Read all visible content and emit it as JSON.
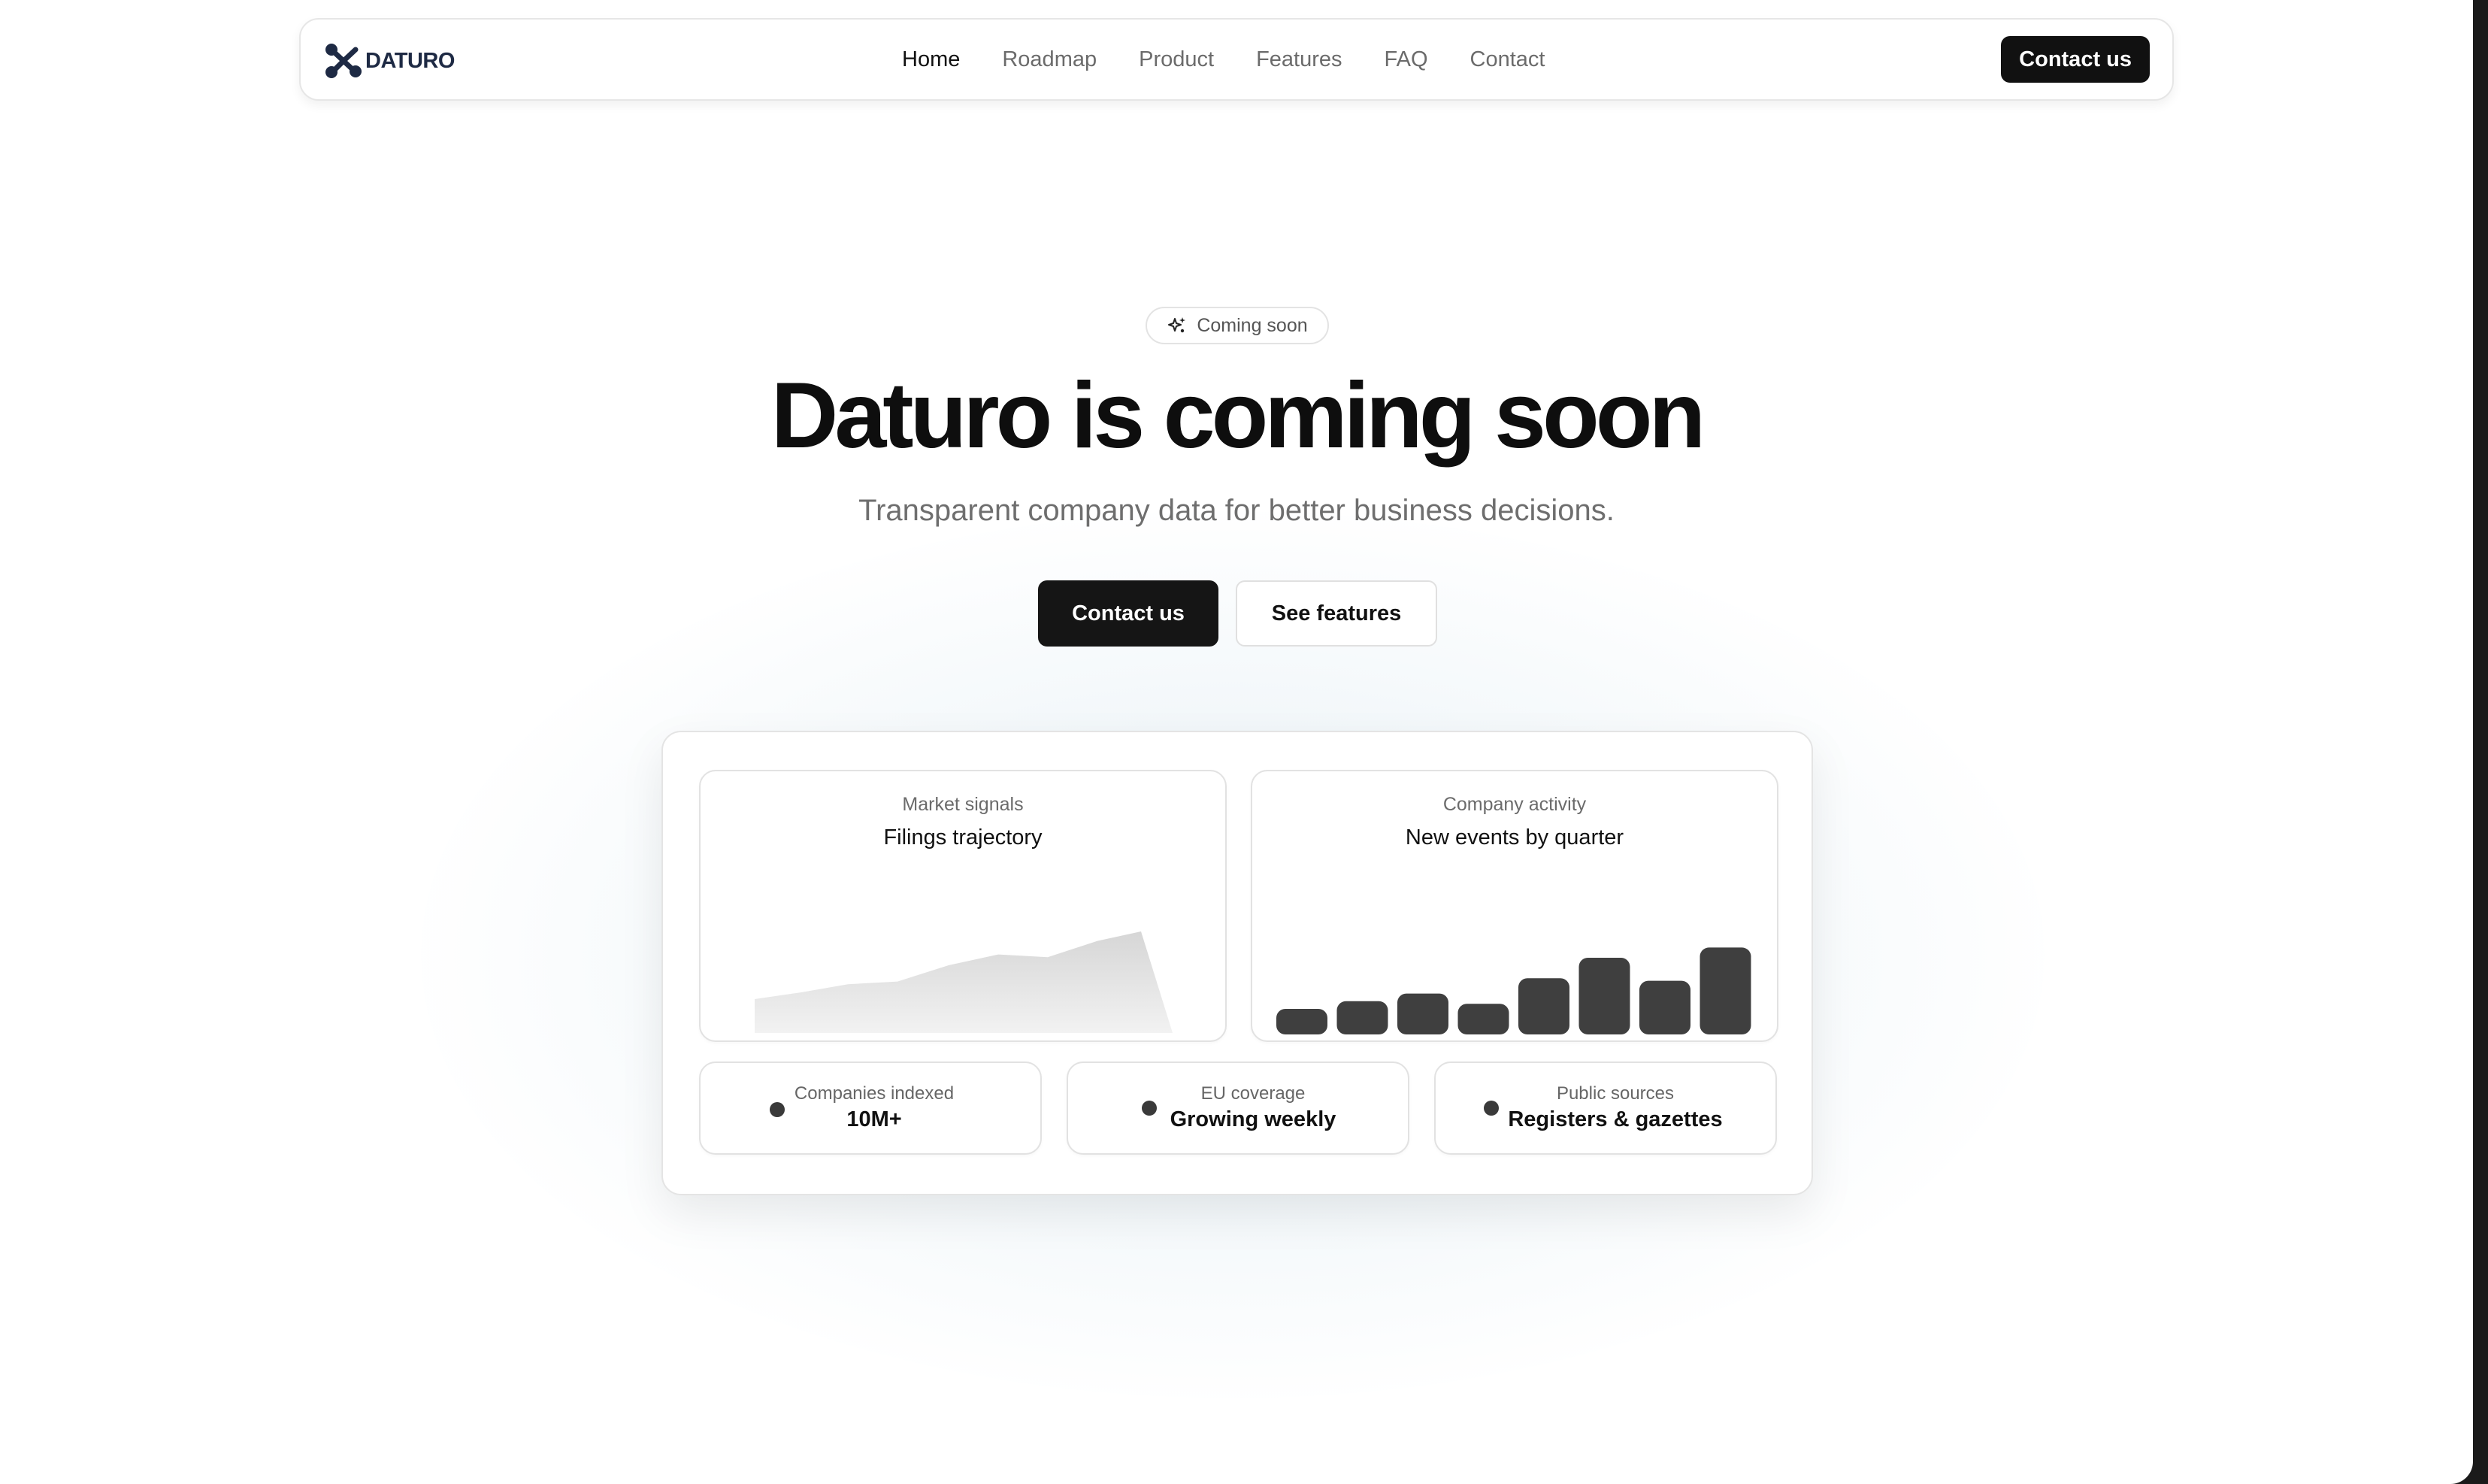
{
  "nav": {
    "brand": "DATURO",
    "links": [
      {
        "label": "Home",
        "active": true
      },
      {
        "label": "Roadmap",
        "active": false
      },
      {
        "label": "Product",
        "active": false
      },
      {
        "label": "Features",
        "active": false
      },
      {
        "label": "FAQ",
        "active": false
      },
      {
        "label": "Contact",
        "active": false
      }
    ],
    "cta_label": "Contact us"
  },
  "hero": {
    "badge_icon": "sparkles-icon",
    "badge_label": "Coming soon",
    "title": "Daturo is coming soon",
    "subtitle": "Transparent company data for better business decisions.",
    "primary_button": "Contact us",
    "secondary_button": "See features"
  },
  "dashboard": {
    "market_card": {
      "eyebrow": "Market signals",
      "title": "Filings trajectory"
    },
    "activity_card": {
      "eyebrow": "Company activity",
      "title": "New events by quarter"
    },
    "stats": [
      {
        "label": "Companies indexed",
        "value": "10M+"
      },
      {
        "label": "EU coverage",
        "value": "Growing weekly"
      },
      {
        "label": "Public sources",
        "value": "Registers & gazettes"
      }
    ]
  },
  "chart_data": [
    {
      "type": "area",
      "title": "Filings trajectory",
      "values": [
        0.25,
        0.3,
        0.36,
        0.38,
        0.5,
        0.58,
        0.56,
        0.68,
        0.75,
        0
      ]
    },
    {
      "type": "bar",
      "title": "New events by quarter",
      "values": [
        0.2,
        0.26,
        0.32,
        0.24,
        0.44,
        0.6,
        0.42,
        0.68
      ]
    }
  ],
  "colors": {
    "brand": "#1e2a44",
    "primary": "#111111",
    "bar": "#3f3f3f",
    "muted_text": "#6b6b6b"
  }
}
